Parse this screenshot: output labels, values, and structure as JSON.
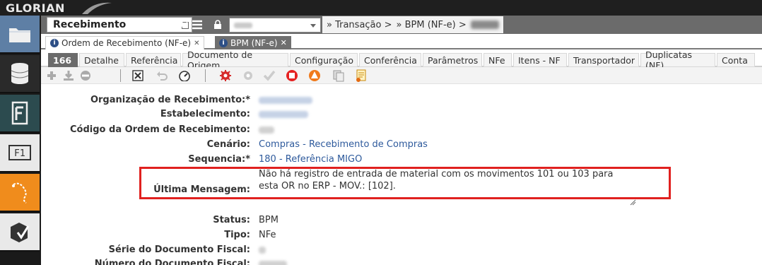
{
  "app": {
    "logo": "GLORIAN"
  },
  "header": {
    "title": "Recebimento",
    "menu_label": "MENU",
    "breadcrumbs": [
      "» Transação >",
      "» BPM (NF-e) >"
    ]
  },
  "doc_tabs": [
    {
      "label": "Ordem de Recebimento (NF-e)",
      "close": "✕"
    },
    {
      "label": "BPM (NF-e)",
      "close": "✕"
    }
  ],
  "section_tabs": [
    "166",
    "Detalhe",
    "Referência",
    "Documento de Origem",
    "Configuração",
    "Conferência",
    "Parâmetros",
    "NFe",
    "Itens - NF",
    "Transportador",
    "Duplicatas (NF)",
    "Conta"
  ],
  "form": {
    "organizacao": {
      "label": "Organização de Recebimento:*"
    },
    "estabelecimento": {
      "label": "Estabelecimento:"
    },
    "codigo": {
      "label": "Código da Ordem de Recebimento:"
    },
    "cenario": {
      "label": "Cenário:",
      "value": "Compras - Recebimento de Compras"
    },
    "sequencia": {
      "label": "Sequencia:*",
      "value": "180 - Referência MIGO"
    },
    "ultima_mensagem": {
      "label": "Última Mensagem:",
      "line1": "Não há registro de entrada de material com os movimentos 101 ou 103 para",
      "line2": "esta OR no ERP - MOV.: [102]."
    },
    "status": {
      "label": "Status:",
      "value": "BPM"
    },
    "tipo": {
      "label": "Tipo:",
      "value": "NFe"
    },
    "serie": {
      "label": "Série do Documento Fiscal:"
    },
    "numero": {
      "label": "Número do Documento Fiscal:"
    }
  },
  "colors": {
    "header_gray": "#6b6b6b",
    "highlight_red": "#e0211f",
    "link_blue": "#2e5a9c"
  }
}
